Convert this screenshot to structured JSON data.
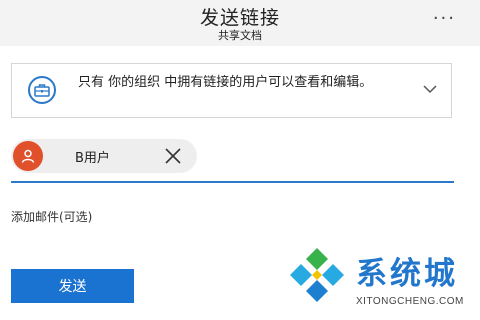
{
  "header": {
    "title": "发送链接",
    "subtitle": "共享文档",
    "more_label": "..."
  },
  "permission": {
    "text": "只有 你的组织 中拥有链接的用户可以查看和编辑。",
    "icon": "briefcase-icon",
    "chevron_icon": "chevron-down-icon"
  },
  "recipient": {
    "name": "B用户",
    "avatar_color": "#e0502a",
    "avatar_icon": "person-icon",
    "remove_icon": "close-icon"
  },
  "message": {
    "placeholder": "添加邮件(可选)"
  },
  "actions": {
    "send_label": "发送",
    "send_color": "#1a73d1"
  },
  "watermark": {
    "name": "系统城",
    "url": "XITONGCHENG.COM"
  },
  "colors": {
    "accent": "#2b79c9",
    "header_bg": "#f3f3f3"
  }
}
